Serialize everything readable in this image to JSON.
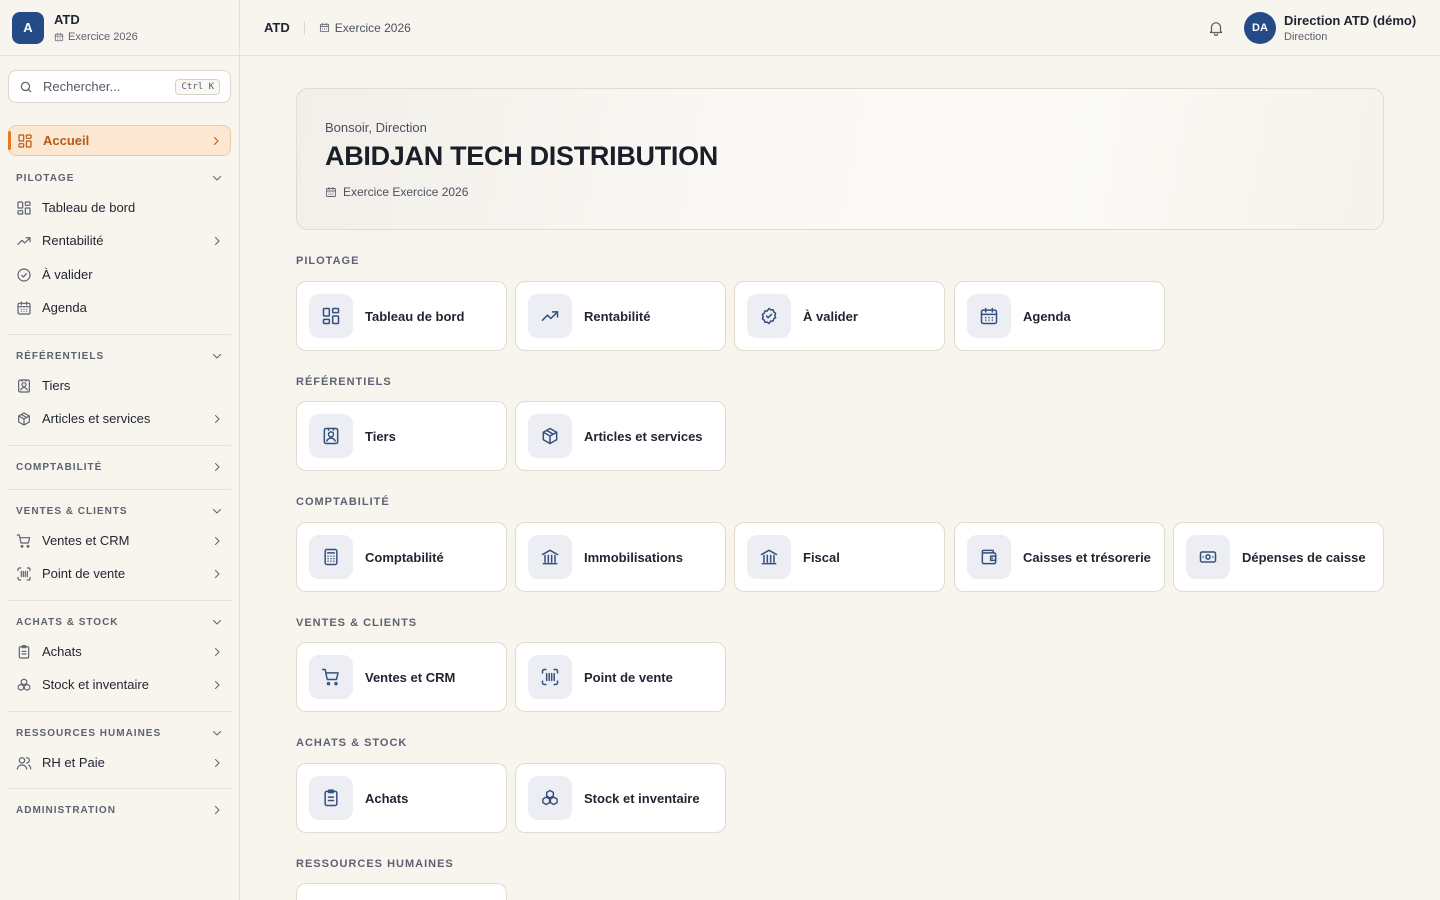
{
  "brand": {
    "logo_letter": "A",
    "name": "ATD",
    "exercise": "Exercice 2026"
  },
  "search": {
    "placeholder": "Rechercher...",
    "shortcut": "Ctrl K"
  },
  "sidebar": {
    "home": "Accueil",
    "pilotage": {
      "title": "PILOTAGE",
      "items": [
        "Tableau de bord",
        "Rentabilité",
        "À valider",
        "Agenda"
      ]
    },
    "referentiels": {
      "title": "RÉFÉRENTIELS",
      "items": [
        "Tiers",
        "Articles et services"
      ]
    },
    "comptabilite": {
      "title": "COMPTABILITÉ"
    },
    "ventes": {
      "title": "VENTES & CLIENTS",
      "items": [
        "Ventes et CRM",
        "Point de vente"
      ]
    },
    "achats": {
      "title": "ACHATS & STOCK",
      "items": [
        "Achats",
        "Stock et inventaire"
      ]
    },
    "rh": {
      "title": "RESSOURCES HUMAINES",
      "items": [
        "RH et Paie"
      ]
    },
    "administration": {
      "title": "ADMINISTRATION"
    }
  },
  "topbar": {
    "org": "ATD",
    "exercise": "Exercice 2026"
  },
  "user": {
    "initials": "DA",
    "name": "Direction ATD (démo)",
    "role": "Direction"
  },
  "hero": {
    "greeting": "Bonsoir, Direction",
    "company": "ABIDJAN TECH DISTRIBUTION",
    "exercise": "Exercice Exercice 2026"
  },
  "sections": {
    "pilotage": {
      "title": "PILOTAGE",
      "cards": [
        "Tableau de bord",
        "Rentabilité",
        "À valider",
        "Agenda"
      ]
    },
    "referentiels": {
      "title": "RÉFÉRENTIELS",
      "cards": [
        "Tiers",
        "Articles et services"
      ]
    },
    "comptabilite": {
      "title": "COMPTABILITÉ",
      "cards": [
        "Comptabilité",
        "Immobilisations",
        "Fiscal",
        "Caisses et trésorerie",
        "Dépenses de caisse"
      ]
    },
    "ventes": {
      "title": "VENTES & CLIENTS",
      "cards": [
        "Ventes et CRM",
        "Point de vente"
      ]
    },
    "achats": {
      "title": "ACHATS & STOCK",
      "cards": [
        "Achats",
        "Stock et inventaire"
      ]
    },
    "rh": {
      "title": "RESSOURCES HUMAINES"
    }
  },
  "colors": {
    "accent": "#e07a26",
    "brand": "#244b87",
    "background": "#f8f5ef"
  }
}
